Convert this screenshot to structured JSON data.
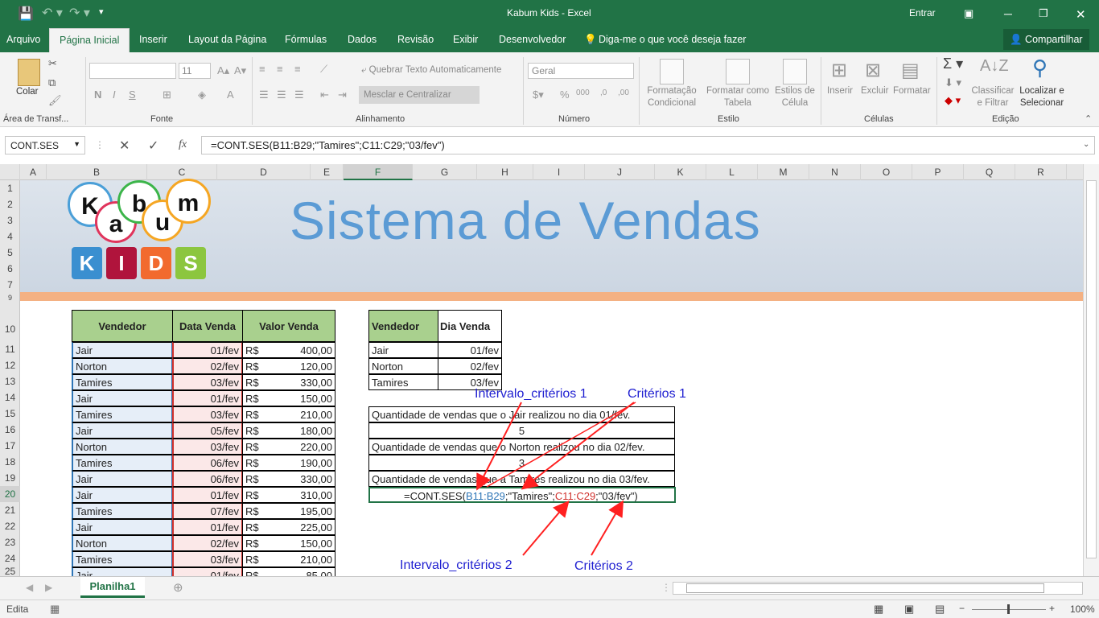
{
  "window": {
    "title": "Kabum Kids  -  Excel",
    "signin": "Entrar"
  },
  "tabs": [
    "Arquivo",
    "Página Inicial",
    "Inserir",
    "Layout da Página",
    "Fórmulas",
    "Dados",
    "Revisão",
    "Exibir",
    "Desenvolvedor"
  ],
  "tell_me": "Diga-me o que você deseja fazer",
  "share": "Compartilhar",
  "ribbon": {
    "paste": "Colar",
    "clipboard": "Área de Transf...",
    "font_size": "11",
    "font_group": "Fonte",
    "wrap": "Quebrar Texto Automaticamente",
    "merge": "Mesclar e Centralizar",
    "align_group": "Alinhamento",
    "number_format": "Geral",
    "number_group": "Número",
    "cond_format": "Formatação Condicional",
    "format_table": "Formatar como Tabela",
    "cell_styles": "Estilos de Célula",
    "styles_group": "Estilo",
    "insert": "Inserir",
    "delete": "Excluir",
    "format": "Formatar",
    "cells_group": "Células",
    "sort": "Classificar e Filtrar",
    "find": "Localizar e Selecionar",
    "edit_group": "Edição"
  },
  "formula_bar": {
    "name_box": "CONT.SES",
    "formula": "=CONT.SES(B11:B29;\"Tamires\";C11:C29;\"03/fev\")"
  },
  "columns": [
    "A",
    "B",
    "C",
    "D",
    "E",
    "F",
    "G",
    "H",
    "I",
    "J",
    "K",
    "L",
    "M",
    "N",
    "O",
    "P",
    "Q",
    "R"
  ],
  "rows": [
    "1",
    "2",
    "3",
    "4",
    "5",
    "6",
    "7",
    "9",
    "10",
    "11",
    "12",
    "13",
    "14",
    "15",
    "16",
    "17",
    "18",
    "19",
    "20",
    "21",
    "22",
    "23",
    "24",
    "25"
  ],
  "banner": {
    "title": "Sistema de Vendas",
    "logo_top": [
      "K",
      "a",
      "b",
      "u",
      "m"
    ],
    "logo_bottom": [
      "K",
      "I",
      "D",
      "S"
    ]
  },
  "sales_table": {
    "headers": [
      "Vendedor",
      "Data Venda",
      "Valor Venda"
    ],
    "currency": "R$",
    "rows": [
      [
        "Jair",
        "01/fev",
        "400,00"
      ],
      [
        "Norton",
        "02/fev",
        "120,00"
      ],
      [
        "Tamires",
        "03/fev",
        "330,00"
      ],
      [
        "Jair",
        "01/fev",
        "150,00"
      ],
      [
        "Tamires",
        "03/fev",
        "210,00"
      ],
      [
        "Jair",
        "05/fev",
        "180,00"
      ],
      [
        "Norton",
        "03/fev",
        "220,00"
      ],
      [
        "Tamires",
        "06/fev",
        "190,00"
      ],
      [
        "Jair",
        "06/fev",
        "330,00"
      ],
      [
        "Jair",
        "01/fev",
        "310,00"
      ],
      [
        "Tamires",
        "07/fev",
        "195,00"
      ],
      [
        "Jair",
        "01/fev",
        "225,00"
      ],
      [
        "Norton",
        "02/fev",
        "150,00"
      ],
      [
        "Tamires",
        "03/fev",
        "210,00"
      ],
      [
        "Jair",
        "01/fev",
        "85,00"
      ]
    ]
  },
  "criteria_table": {
    "headers": [
      "Vendedor",
      "Dia Venda"
    ],
    "rows": [
      [
        "Jair",
        "01/fev"
      ],
      [
        "Norton",
        "02/fev"
      ],
      [
        "Tamires",
        "03/fev"
      ]
    ]
  },
  "questions": [
    {
      "text": "Quantidade de vendas que o Jair realizou no dia 01/fev.",
      "answer": "5"
    },
    {
      "text": "Quantidade de vendas que o Norton realizou no dia 02/fev.",
      "answer": "3"
    },
    {
      "text": "Quantidade de vendas que a Tamires realizou no dia 03/fev."
    }
  ],
  "editing_formula": {
    "prefix": "=CONT.SES(",
    "range1": "B11:B29",
    "crit1": ";\"Tamires\";",
    "range2": "C11:C29",
    "crit2": ";\"03/fev\")"
  },
  "annotations": {
    "range1": "Intervalo_critérios 1",
    "crit1": "Critérios 1",
    "range2": "Intervalo_critérios  2",
    "crit2": "Critérios 2"
  },
  "sheet_tab": "Planilha1",
  "status": {
    "mode": "Edita",
    "zoom": "100%"
  },
  "colors": {
    "excel_green": "#217346",
    "header_green": "#a9d08e",
    "annotation_blue": "#1f1fd1",
    "arrow_red": "#ff2020",
    "title_blue": "#5b9bd5"
  }
}
